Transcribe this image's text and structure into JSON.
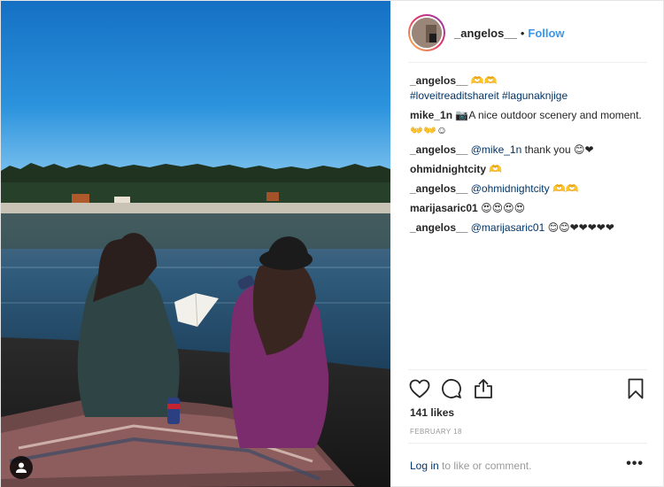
{
  "header": {
    "username": "_angelos__",
    "separator": "•",
    "follow_label": "Follow"
  },
  "comments": [
    {
      "user": "_angelos__",
      "text": "🫶🫶",
      "tags": "#loveitreaditshareit #lagunaknjige"
    },
    {
      "user": "mike_1n",
      "text": "📷A nice outdoor scenery and moment.👐👐☺"
    },
    {
      "user": "_angelos__",
      "tag": "@mike_1n",
      "text": "thank you 😊❤"
    },
    {
      "user": "ohmidnightcity",
      "text": "🫶"
    },
    {
      "user": "_angelos__",
      "tag": "@ohmidnightcity",
      "text": "🫶🫶"
    },
    {
      "user": "marijasaric01",
      "text": "😍😍😍😍"
    },
    {
      "user": "_angelos__",
      "tag": "@marijasaric01",
      "text": "😊😊❤❤❤❤❤"
    }
  ],
  "likes": "141 likes",
  "date": "FEBRUARY 18",
  "footer": {
    "login_label": "Log in",
    "suffix": "to like or comment.",
    "more_label": "•••"
  },
  "icons": {
    "like": "heart-icon",
    "comment": "comment-icon",
    "share": "share-icon",
    "save": "bookmark-icon",
    "user_tag": "user-icon"
  },
  "colors": {
    "link_blue": "#3897f0",
    "tag_blue": "#003569",
    "muted": "#999999",
    "text": "#262626"
  }
}
